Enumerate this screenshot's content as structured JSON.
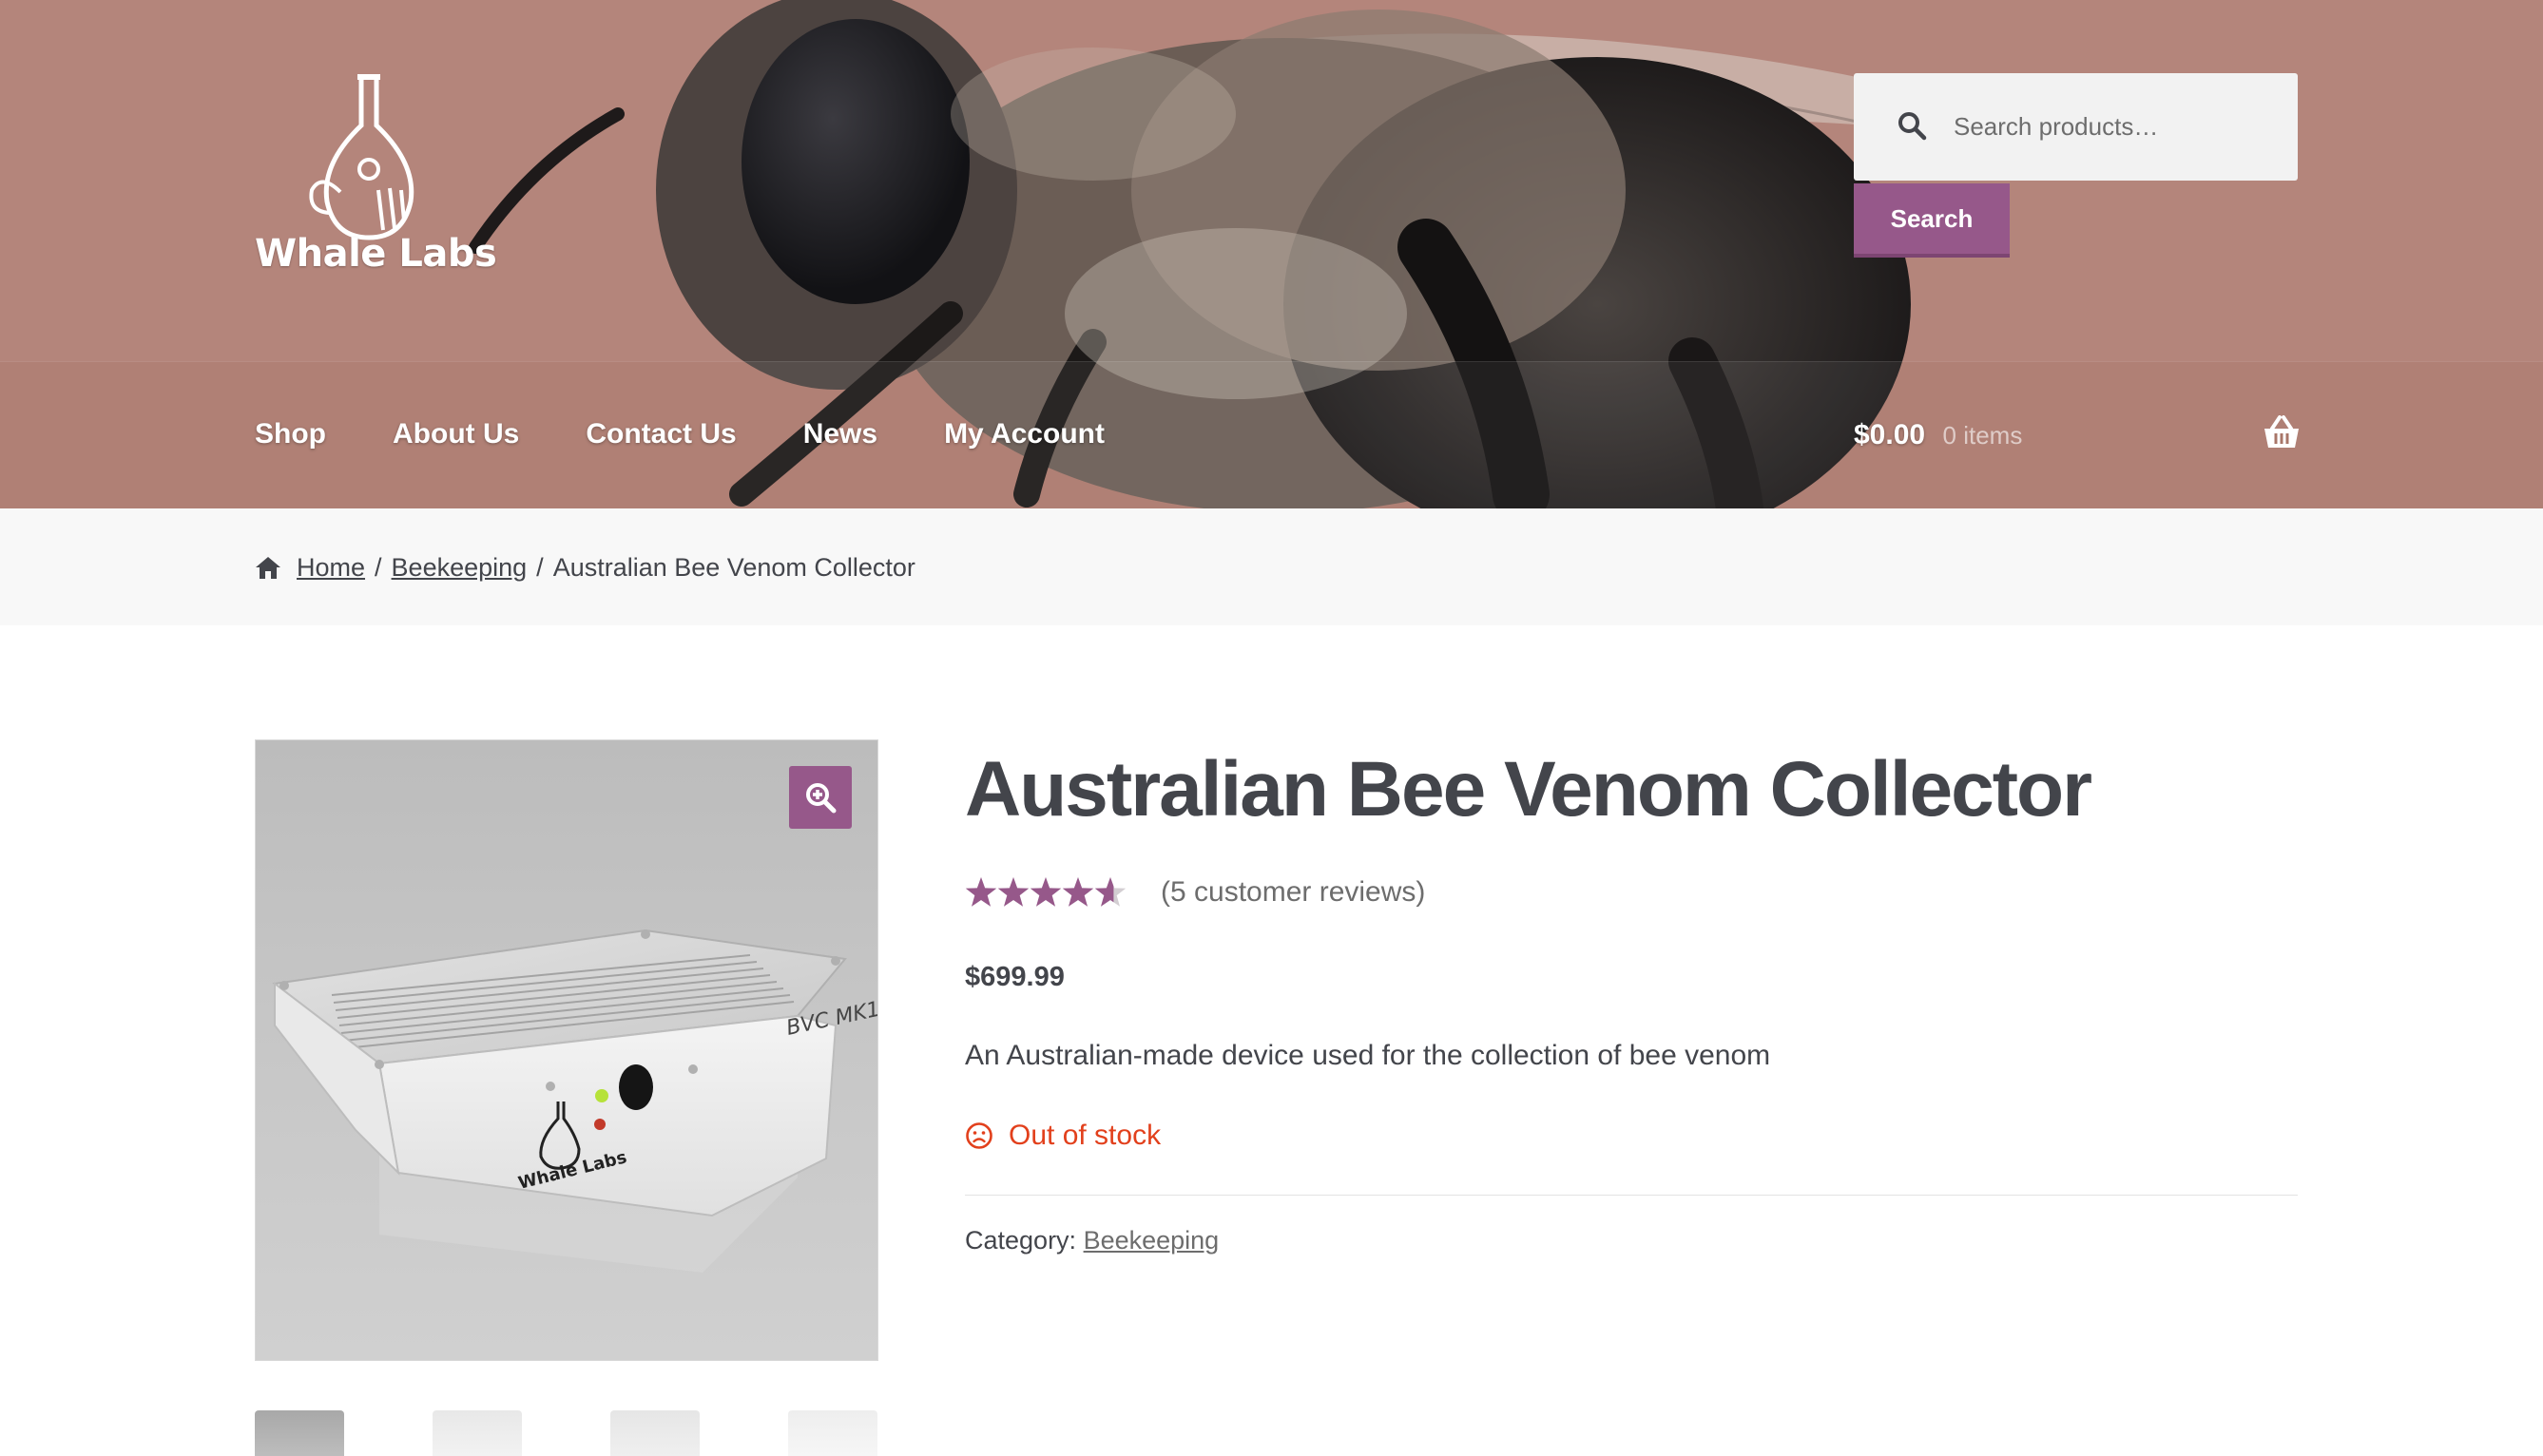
{
  "site": {
    "logo_text": "Whale Labs",
    "accent_color": "#96588a",
    "out_of_stock_color": "#e2401c"
  },
  "search": {
    "placeholder": "Search products…",
    "button_label": "Search",
    "icon": "search-icon"
  },
  "nav": {
    "items": [
      {
        "label": "Shop"
      },
      {
        "label": "About Us"
      },
      {
        "label": "Contact Us"
      },
      {
        "label": "News"
      },
      {
        "label": "My Account"
      }
    ]
  },
  "cart": {
    "total": "$0.00",
    "count": "0 items",
    "icon": "basket-icon"
  },
  "breadcrumb": {
    "icon": "home-icon",
    "home": "Home",
    "category": "Beekeeping",
    "separator": "/",
    "current": "Australian Bee Venom Collector"
  },
  "product": {
    "title": "Australian Bee Venom Collector",
    "rating": 4.6,
    "rating_max": 5,
    "reviews": "(5 customer reviews)",
    "price": "$699.99",
    "description": "An Australian-made device used for the collection of bee venom",
    "stock": "Out of stock",
    "category_label": "Category:",
    "category": "Beekeeping",
    "zoom_icon": "zoom-in-icon",
    "thumbnail_count": 4,
    "image_device_label": "BVC MK1",
    "image_logo_text": "Whale Labs"
  }
}
